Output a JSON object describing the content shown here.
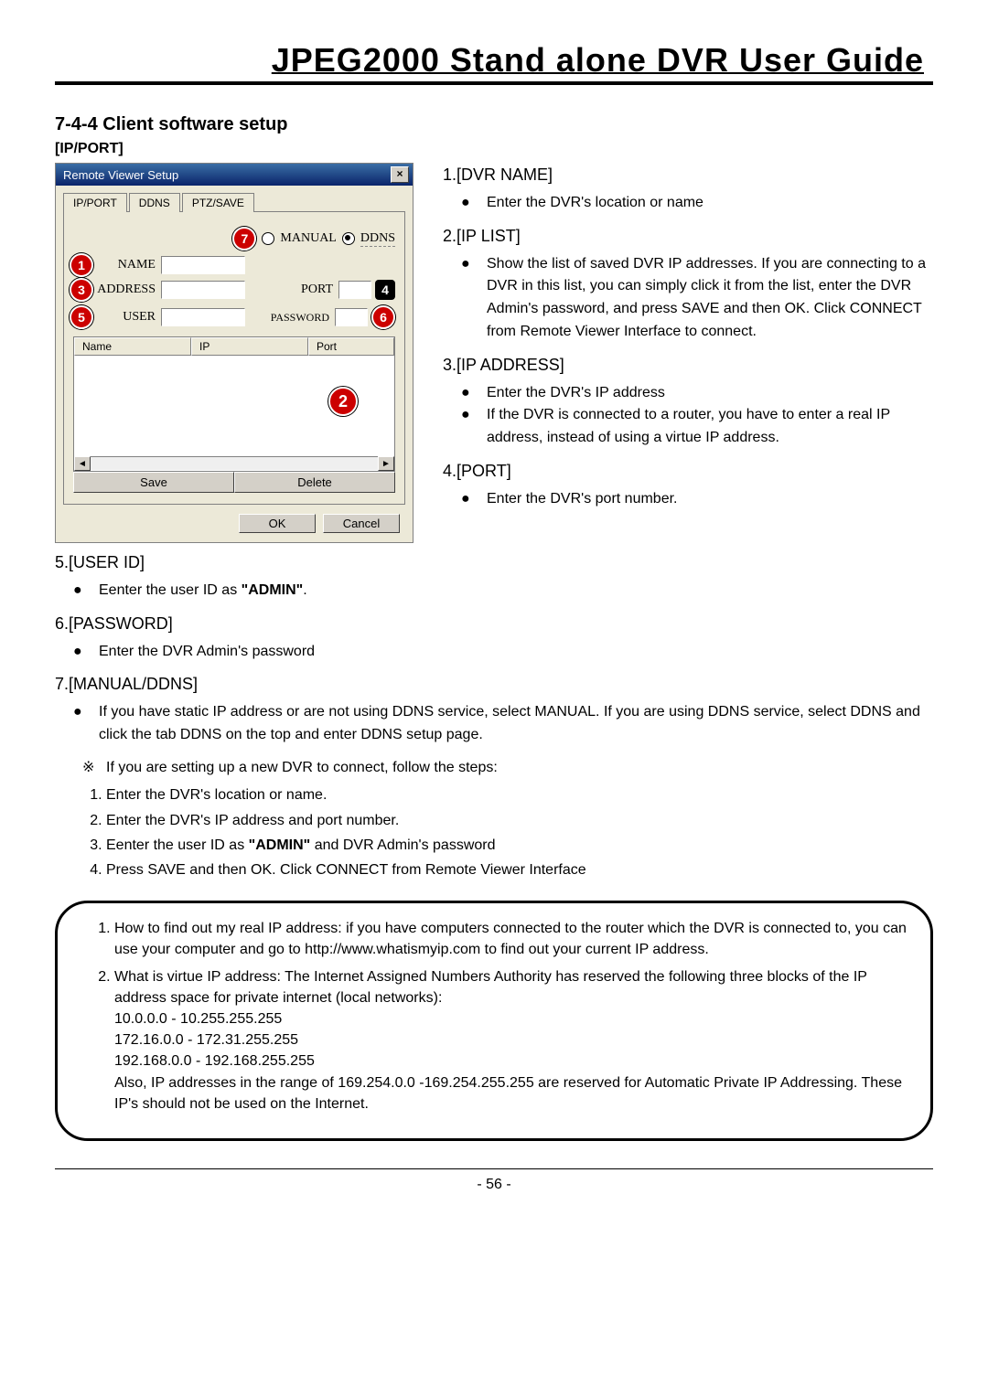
{
  "title": "JPEG2000  Stand  alone  DVR  User  Guide",
  "section": "7-4-4 Client software setup",
  "sub": "[IP/PORT]",
  "dialog": {
    "title": "Remote Viewer Setup",
    "tabs": [
      "IP/PORT",
      "DDNS",
      "PTZ/SAVE"
    ],
    "labels": {
      "name": "NAME",
      "address": "ADDRESS",
      "user": "USER",
      "port": "PORT",
      "password": "PASSWORD",
      "manual": "MANUAL",
      "ddns": "DDNS"
    },
    "table": {
      "cols": [
        "Name",
        "IP",
        "Port"
      ]
    },
    "buttons": {
      "save": "Save",
      "delete": "Delete",
      "ok": "OK",
      "cancel": "Cancel"
    }
  },
  "badges": {
    "b1": "1",
    "b2": "2",
    "b3": "3",
    "b4": "4",
    "b5": "5",
    "b6": "6",
    "b7": "7"
  },
  "items": {
    "i1": {
      "head": "1.[DVR NAME]",
      "bullets": [
        "Enter the DVR's location or name"
      ]
    },
    "i2": {
      "head": "2.[IP LIST]",
      "bullets": [
        "Show the list of saved DVR IP addresses. If you are connecting to a DVR in this list, you can simply click it from the list, enter the DVR Admin's password, and press SAVE and then OK. Click CONNECT from Remote Viewer Interface to connect."
      ]
    },
    "i3": {
      "head": "3.[IP ADDRESS]",
      "bullets": [
        "Enter the DVR's IP address",
        "If the DVR is connected to a router, you have to enter a real IP address, instead of using a virtue IP address."
      ]
    },
    "i4": {
      "head": "4.[PORT]",
      "bullets": [
        "Enter the DVR's port number."
      ]
    },
    "i5": {
      "head": "5.[USER ID]",
      "b_pre": "Eenter the user ID as ",
      "b_bold": "\"ADMIN\"",
      "b_post": "."
    },
    "i6": {
      "head": "6.[PASSWORD]",
      "bullets": [
        "Enter the DVR Admin's password"
      ]
    },
    "i7": {
      "head": "7.[MANUAL/DDNS]",
      "bullets": [
        "If you have static IP address or are not using DDNS service, select MANUAL. If you are using DDNS service, select DDNS and click the tab DDNS on the top and enter DDNS setup page."
      ]
    }
  },
  "note": "If you are setting up a new DVR to connect, follow the steps:",
  "steps": {
    "s1": "Enter the DVR's location or name.",
    "s2": "Enter the DVR's IP address and port number.",
    "s3_pre": "Eenter the user ID as ",
    "s3_bold": "\"ADMIN\"",
    "s3_post": " and DVR Admin's password",
    "s4": "Press SAVE and then OK. Click CONNECT from Remote Viewer Interface"
  },
  "callout": {
    "c1": "How to find out my real IP address: if you have computers connected to the router which the DVR is connected to, you can use your computer and go to http://www.whatismyip.com to find out your current IP address.",
    "c2a": "What is virtue IP address: The Internet Assigned Numbers Authority has reserved the following three blocks of the IP address space for private internet (local networks):",
    "c2b": "10.0.0.0 - 10.255.255.255",
    "c2c": "172.16.0.0 - 172.31.255.255",
    "c2d": "192.168.0.0 - 192.168.255.255",
    "c2e": " Also, IP addresses in the range of 169.254.0.0 -169.254.255.255 are reserved for Automatic Private IP Addressing. These IP's should not be used on the Internet."
  },
  "page_num": "- 56 -"
}
